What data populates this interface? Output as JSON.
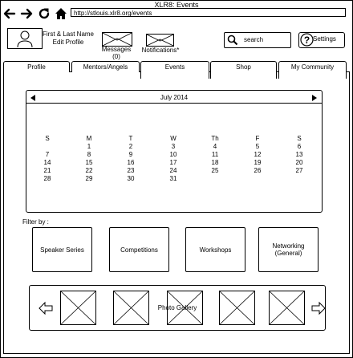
{
  "window": {
    "title": "XLR8: Events"
  },
  "browser": {
    "url": "http://stlouis.xlr8.org/events",
    "icons": [
      "back-arrow-icon",
      "forward-arrow-icon",
      "reload-icon",
      "home-icon"
    ]
  },
  "header": {
    "profile_line1": "First & Last Name",
    "profile_line2": "Edit Profile",
    "messages_label": "Messages",
    "messages_count": "(0)",
    "notifications_label": "Notifications*",
    "search_label": "search",
    "settings_label": "Settings"
  },
  "tabs": [
    {
      "label": "Profile",
      "active": false
    },
    {
      "label": "Mentors/Angels",
      "active": false
    },
    {
      "label": "Events",
      "active": true
    },
    {
      "label": "Shop",
      "active": false
    },
    {
      "label": "My Community",
      "active": false
    }
  ],
  "calendar": {
    "month": "July 2014",
    "weekdays": [
      "S",
      "M",
      "T",
      "W",
      "Th",
      "F",
      "S"
    ],
    "weeks": [
      [
        "",
        "1",
        "2",
        "3",
        "4",
        "5",
        "6"
      ],
      [
        "7",
        "8",
        "9",
        "10",
        "11",
        "12",
        "13"
      ],
      [
        "14",
        "15",
        "16",
        "17",
        "18",
        "19",
        "20"
      ],
      [
        "21",
        "22",
        "23",
        "24",
        "25",
        "26",
        "27"
      ],
      [
        "28",
        "29",
        "30",
        "31",
        "",
        "",
        ""
      ]
    ]
  },
  "filter": {
    "label": "Filter by :",
    "options": [
      "Speaker Series",
      "Competitions",
      "Workshops",
      "Networking\n(General)"
    ]
  },
  "gallery": {
    "title": "Photo Gallery",
    "photo_count": 5
  },
  "colors": {
    "stroke": "#000000",
    "background": "#ffffff"
  }
}
